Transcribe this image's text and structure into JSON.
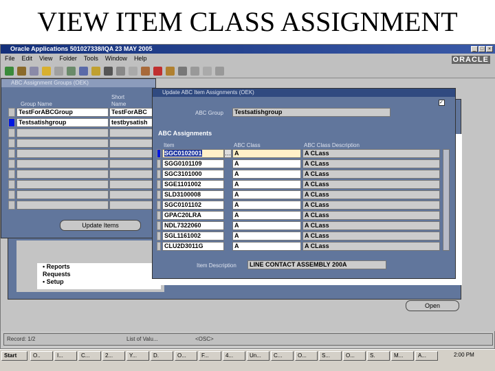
{
  "slide_title": "VIEW ITEM CLASS ASSIGNMENT",
  "app": {
    "title": "Oracle Applications  501027338/IQA  23 MAY 2005",
    "logo": "ORACLE",
    "menu": [
      "File",
      "Edit",
      "View",
      "Folder",
      "Tools",
      "Window",
      "Help"
    ]
  },
  "groups_window": {
    "title": "ABC Assignment Groups (OEK)",
    "headers": {
      "group_name": "Group Name",
      "short_name": "Short Name"
    },
    "rows": [
      {
        "group": "TestForABCGroup",
        "short": "TestForABC"
      },
      {
        "group": "Testsatishgroup",
        "short": "testbysatish"
      }
    ],
    "empty_rows": 8,
    "update_button": "Update Items"
  },
  "navigator": {
    "items": [
      "Reports",
      "Requests",
      "Setup"
    ],
    "open_button": "Open"
  },
  "items_window": {
    "title": "Update ABC Item Assignments (OEK)",
    "abc_group_label": "ABC Group",
    "abc_group_value": "Testsatishgroup",
    "section": "ABC Assignments",
    "headers": {
      "item": "Item",
      "class": "ABC Class",
      "desc": "ABC Class Description"
    },
    "rows": [
      {
        "item": "SGC0102001",
        "class": "A",
        "desc": "A CLass"
      },
      {
        "item": "SGG0101109",
        "class": "A",
        "desc": "A CLass"
      },
      {
        "item": "SGC3101000",
        "class": "A",
        "desc": "A CLass"
      },
      {
        "item": "SGE1101002",
        "class": "A",
        "desc": "A CLass"
      },
      {
        "item": "SLD3100008",
        "class": "A",
        "desc": "A CLass"
      },
      {
        "item": "SGC0101102",
        "class": "A",
        "desc": "A CLass"
      },
      {
        "item": "GPAC20LRA",
        "class": "A",
        "desc": "A CLass"
      },
      {
        "item": "NDL7322060",
        "class": "A",
        "desc": "A CLass"
      },
      {
        "item": "SGL1161002",
        "class": "A",
        "desc": "A CLass"
      },
      {
        "item": "CLU2D3011G",
        "class": "A",
        "desc": "A CLass"
      }
    ],
    "item_desc_label": "Item Description",
    "item_desc_value": "LINE CONTACT   ASSEMBLY 200A"
  },
  "status": {
    "record": "Record: 1/2",
    "lov": "List of Valu...",
    "mode": "<OSC>"
  },
  "taskbar": {
    "start": "Start",
    "clock": "2:00 PM",
    "tasks": [
      "O..",
      "I...",
      "C...",
      "2...",
      "Y...",
      "D.",
      "O...",
      "F...",
      "4...",
      "Un...",
      "C...",
      "O...",
      "S...",
      "O...",
      "S.",
      "M...",
      "A..."
    ]
  }
}
